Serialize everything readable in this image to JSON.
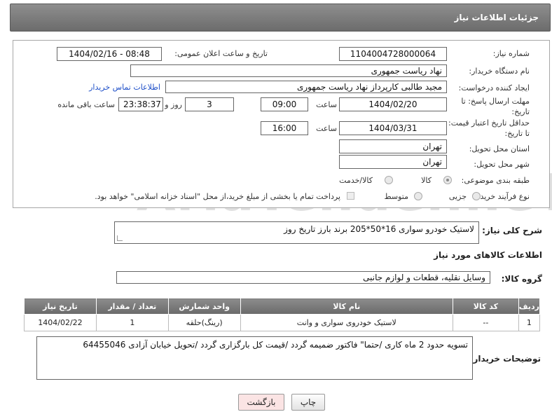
{
  "header": {
    "title": "جزئیات اطلاعات نیاز"
  },
  "form": {
    "need_number_label": "شماره نیاز:",
    "need_number": "1104004728000064",
    "announce_label": "تاریخ و ساعت اعلان عمومی:",
    "announce_value": "1404/02/16 - 08:48",
    "buyer_org_label": "نام دستگاه خریدار:",
    "buyer_org": "نهاد ریاست جمهوری",
    "requester_label": "ایجاد کننده درخواست:",
    "requester": "مجید طالبی کارپرداز نهاد ریاست جمهوری",
    "contact_link": "اطلاعات تماس خریدار",
    "reply_deadline_label_1": "مهلت ارسال پاسخ: تا",
    "reply_deadline_label_2": "تاریخ:",
    "reply_date": "1404/02/20",
    "time_label": "ساعت",
    "reply_time": "09:00",
    "days": "3",
    "days_label": "روز و",
    "remaining_time": "23:38:37",
    "remaining_label": "ساعت باقی مانده",
    "price_validity_label_1": "حداقل تاریخ اعتبار قیمت:",
    "price_validity_label_2": "تا تاریخ:",
    "price_date": "1404/03/31",
    "price_time": "16:00",
    "province_label": "استان محل تحویل:",
    "province": "تهران",
    "city_label": "شهر محل تحویل:",
    "city": "تهران",
    "category_label": "طبقه بندی موضوعی:",
    "category_options": [
      "کالا",
      "کالا/خدمت"
    ],
    "process_label": "نوع فرآیند خرید :",
    "process_options": [
      "جزیی",
      "متوسط"
    ],
    "payment_note": "پرداخت تمام یا بخشی از مبلغ خرید،از محل \"اسناد خزانه اسلامی\" خواهد بود."
  },
  "description": {
    "label": "شرح کلی نیاز:",
    "value": "لاستیک خودرو سواری 16*50*205  برند بارز تاریخ روز"
  },
  "goods": {
    "section_title": "اطلاعات کالاهای مورد نیاز",
    "group_label": "گروه کالا:",
    "group_value": "وسایل نقلیه، قطعات و لوازم جانبی",
    "columns": [
      "ردیف",
      "کد کالا",
      "نام کالا",
      "واحد شمارش",
      "تعداد / مقدار",
      "تاریخ نیاز"
    ],
    "rows": [
      [
        "1",
        "--",
        "لاستیک خودروی سواری و وانت",
        "(رینگ)حلقه",
        "1",
        "1404/02/22"
      ]
    ]
  },
  "buyer_notes": {
    "label": "توضیحات خریدار:",
    "value": "تسویه حدود 2 ماه کاری /حتما\" فاکتور ضمیمه گردد /قیمت کل بارگزاری گردد /تحویل خیابان آزادی 64455046"
  },
  "buttons": {
    "print": "چاپ",
    "back": "بازگشت"
  },
  "watermark": "AriaTender.neT",
  "colors": {
    "header": "#7a7a7a",
    "link": "#1e4fc8",
    "back_button": "#fbe4e4"
  }
}
